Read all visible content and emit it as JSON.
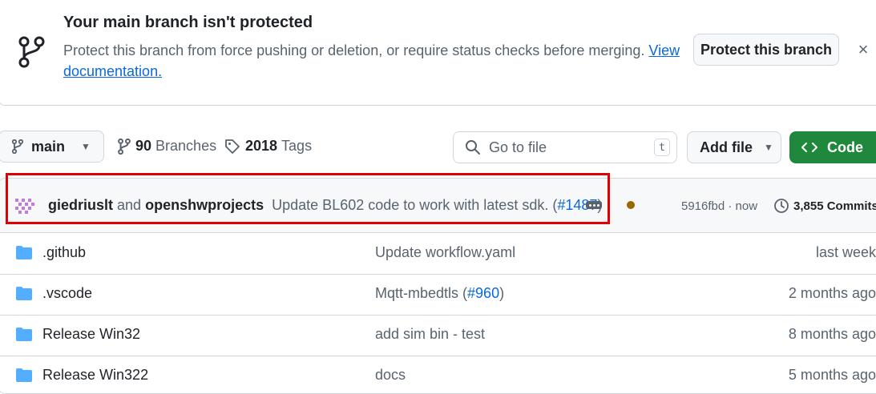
{
  "banner": {
    "title": "Your main branch isn't protected",
    "text": "Protect this branch from force pushing or deletion, or require status checks before merging.",
    "link_text": "View documentation.",
    "protect_label": "Protect this branch",
    "close_label": "×"
  },
  "toolbar": {
    "branch_label": "main",
    "branches_count": "90",
    "branches_label": "Branches",
    "tags_count": "2018",
    "tags_label": "Tags",
    "search_placeholder": "Go to file",
    "search_shortcut": "t",
    "add_file_label": "Add file",
    "code_label": "Code"
  },
  "latest_commit": {
    "author1": "giedriuslt",
    "conjunction": "and",
    "author2": "openshwprojects",
    "message": "Update BL602 code to work with latest sdk. (",
    "pr_link": "#1487",
    "message_end": ")",
    "hash_time": "5916fbd · now",
    "commits_label": "3,855 Commits"
  },
  "files": [
    {
      "name": ".github",
      "message": "Update workflow.yaml",
      "pr": "",
      "message_end": "",
      "time": "last week"
    },
    {
      "name": ".vscode",
      "message": "Mqtt-mbedtls (",
      "pr": "#960",
      "message_end": ")",
      "time": "2 months ago"
    },
    {
      "name": "Release Win32",
      "message": "add sim bin - test",
      "pr": "",
      "message_end": "",
      "time": "8 months ago"
    },
    {
      "name": "Release Win322",
      "message": "docs",
      "pr": "",
      "message_end": "",
      "time": "5 months ago"
    }
  ],
  "colors": {
    "accent": "#0969da",
    "code_button": "#1f883d",
    "highlight_box": "#e00000",
    "status_pending": "#9a6700"
  },
  "icons": [
    "git-branch-icon",
    "caret-down-icon",
    "tag-icon",
    "search-icon",
    "code-icon",
    "history-icon",
    "folder-icon",
    "kebab-icon",
    "close-icon"
  ]
}
